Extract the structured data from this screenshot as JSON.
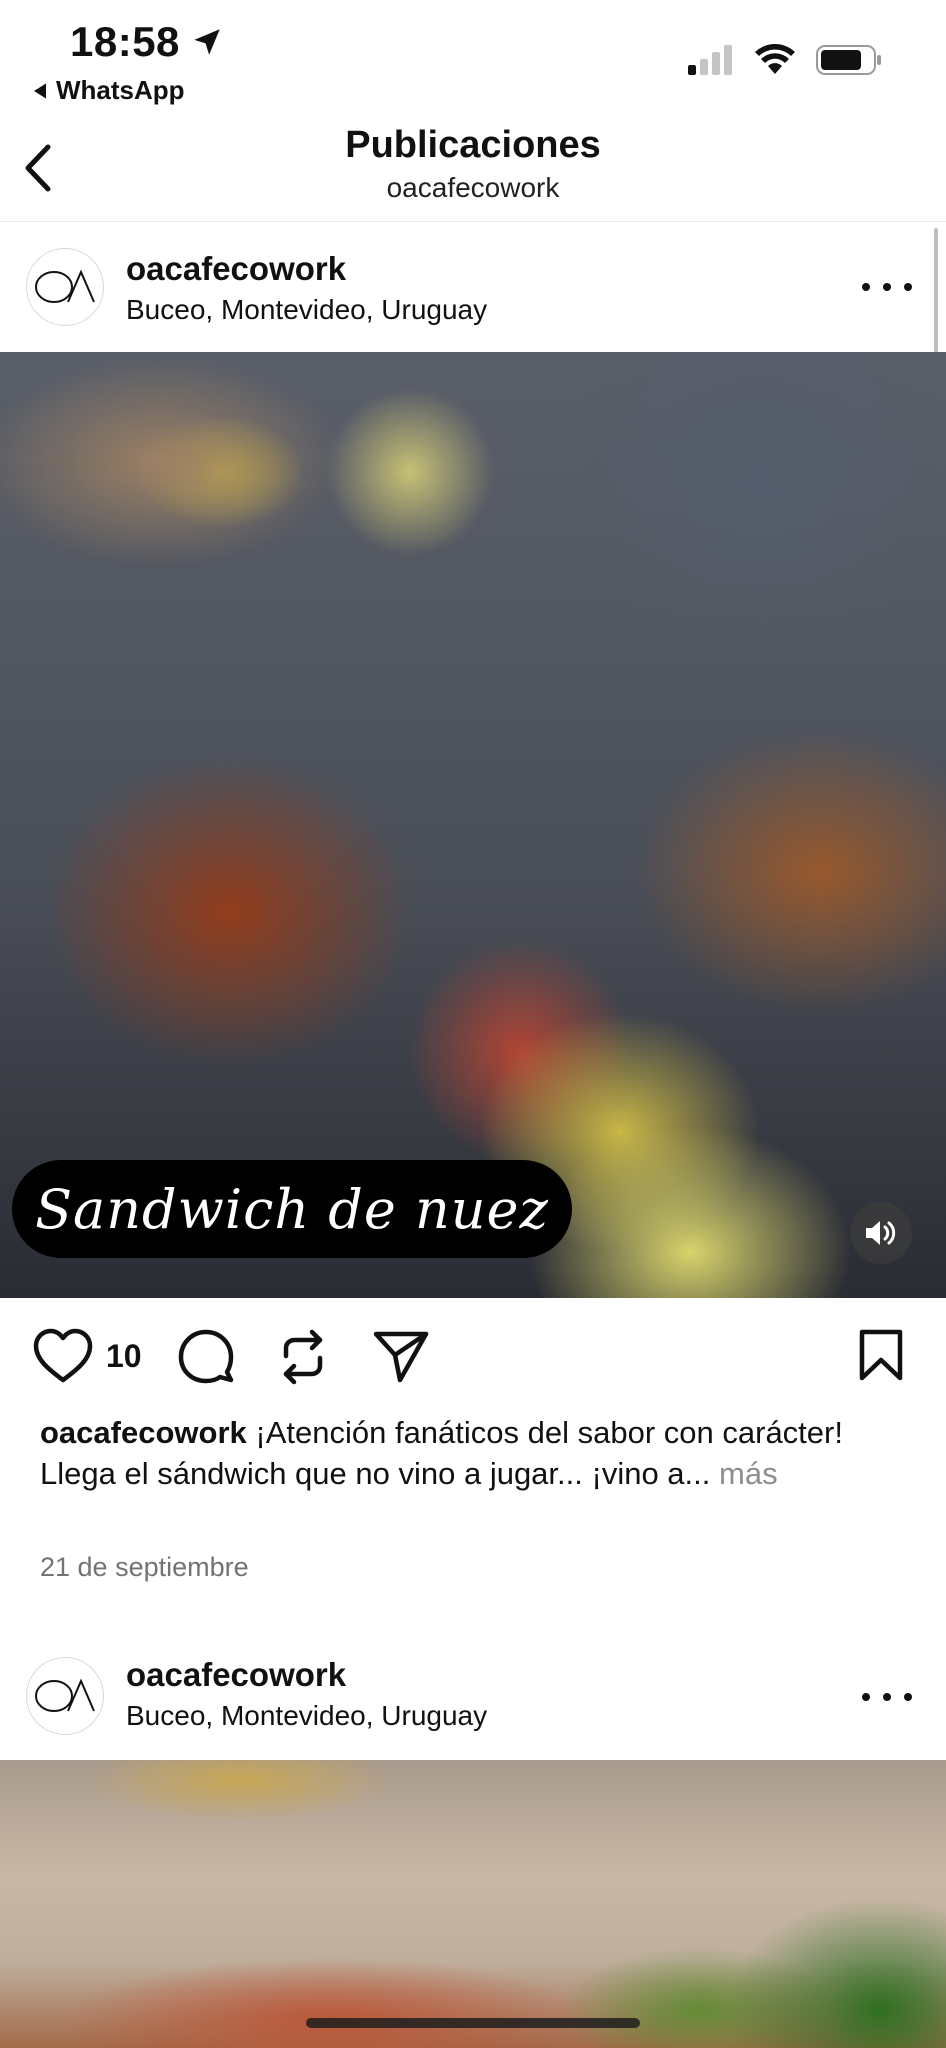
{
  "status_bar": {
    "time": "18:58",
    "back_app": "WhatsApp",
    "icons": [
      "location-arrow-icon",
      "signal-icon",
      "wifi-icon",
      "battery-icon"
    ]
  },
  "nav": {
    "title": "Publicaciones",
    "subtitle": "oacafecowork"
  },
  "posts": [
    {
      "username": "oacafecowork",
      "location": "Buceo, Montevideo, Uruguay",
      "media_caption": "Sandwich de nuez",
      "likes": "10",
      "caption_user": "oacafecowork",
      "caption_line1": " ¡Atención fanáticos del sabor con carácter!",
      "caption_line2": "Llega el sándwich que no vino a jugar... ¡vino a...",
      "more_label": "más",
      "date": "21 de septiembre"
    },
    {
      "username": "oacafecowork",
      "location": "Buceo, Montevideo, Uruguay"
    }
  ]
}
